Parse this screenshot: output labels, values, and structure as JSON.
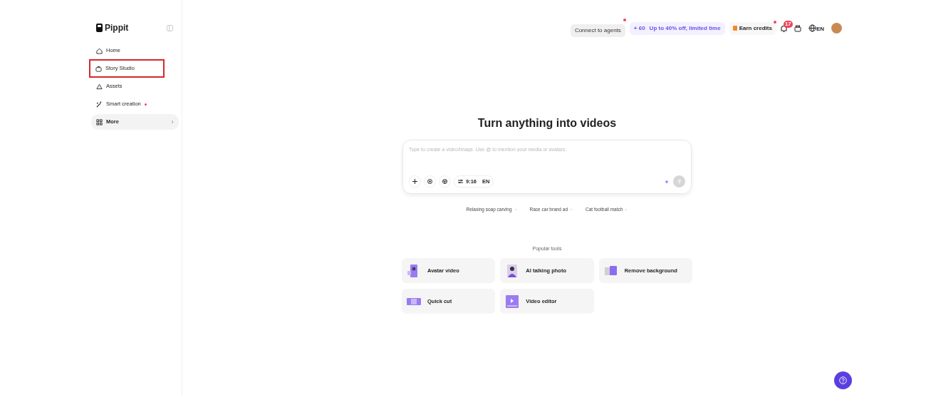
{
  "brand": {
    "name": "Pippit"
  },
  "nav": [
    {
      "label": "Home",
      "highlighted": false,
      "dot": false,
      "selected": false,
      "chevron": false
    },
    {
      "label": "Story Studio",
      "highlighted": true,
      "dot": false,
      "selected": false,
      "chevron": false
    },
    {
      "label": "Assets",
      "highlighted": false,
      "dot": false,
      "selected": false,
      "chevron": false
    },
    {
      "label": "Smart creation",
      "highlighted": false,
      "dot": true,
      "selected": false,
      "chevron": false
    },
    {
      "label": "More",
      "highlighted": false,
      "dot": false,
      "selected": true,
      "chevron": true
    }
  ],
  "header": {
    "connect": "Connect to agents",
    "credits_count": "+ 60",
    "promo": "Up to 40% off, limited time",
    "earn": "Earn credits",
    "notifications": "17",
    "language": "EN"
  },
  "title": "Turn anything into videos",
  "prompt": {
    "placeholder": "Type to create a video/image. Use @ to mention your media or avatars.",
    "ratio": "9:16",
    "language": "EN"
  },
  "suggestions": [
    "Relaxing soap carving",
    "Race car brand ad",
    "Cat football match"
  ],
  "popular_tools": {
    "heading": "Popular tools",
    "items": [
      {
        "label": "Avatar video",
        "kind": "avatar"
      },
      {
        "label": "AI talking photo",
        "kind": "photo"
      },
      {
        "label": "Remove background",
        "kind": "remove"
      },
      {
        "label": "Quick cut",
        "kind": "cut"
      },
      {
        "label": "Video editor",
        "kind": "editor"
      }
    ]
  }
}
